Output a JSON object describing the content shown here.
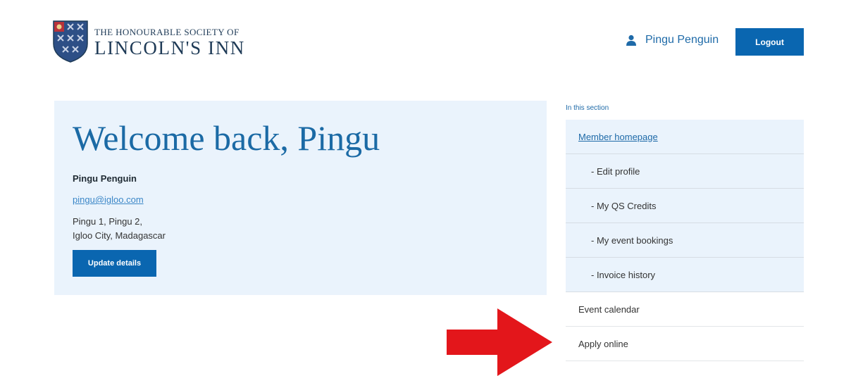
{
  "header": {
    "logo": {
      "line1": "THE HONOURABLE SOCIETY OF",
      "line2": "LINCOLN'S INN",
      "icon": "crest-icon"
    },
    "user": {
      "name": "Pingu Penguin",
      "icon": "user-icon"
    },
    "logout_label": "Logout"
  },
  "welcome": {
    "heading": "Welcome back, Pingu",
    "name": "Pingu Penguin",
    "email": "pingu@igloo.com",
    "address_line1": "Pingu 1, Pingu 2,",
    "address_line2": "Igloo City, Madagascar",
    "update_label": "Update details"
  },
  "sidebar": {
    "section_label": "In this section",
    "items": [
      {
        "label": "Member homepage"
      },
      {
        "label": "- Edit profile"
      },
      {
        "label": "- My QS Credits"
      },
      {
        "label": "- My event bookings"
      },
      {
        "label": "- Invoice history"
      },
      {
        "label": "Event calendar"
      },
      {
        "label": "Apply online"
      }
    ]
  },
  "annotation": {
    "icon": "red-arrow-icon",
    "color": "#e3161b"
  },
  "colors": {
    "brand": "#0a66b0",
    "panel": "#eaf3fc",
    "link": "#1e6aa8"
  }
}
